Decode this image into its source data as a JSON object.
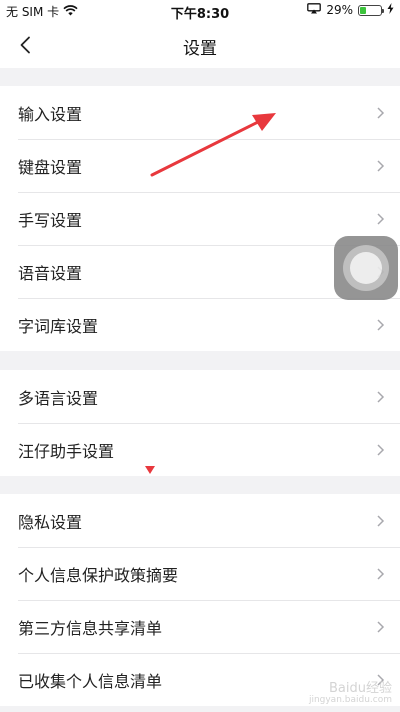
{
  "status_bar": {
    "carrier": "无 SIM 卡",
    "time": "下午8:30",
    "battery_percent": "29%",
    "battery_level": 0.29,
    "icons": [
      "wifi-icon",
      "screen-mirror-icon",
      "battery-icon",
      "charging-bolt-icon"
    ]
  },
  "nav": {
    "title": "设置",
    "back_icon": "chevron-left-icon"
  },
  "groups": [
    {
      "items": [
        {
          "label": "输入设置"
        },
        {
          "label": "键盘设置"
        },
        {
          "label": "手写设置"
        },
        {
          "label": "语音设置"
        },
        {
          "label": "字词库设置"
        }
      ]
    },
    {
      "items": [
        {
          "label": "多语言设置"
        },
        {
          "label": "汪仔助手设置"
        }
      ]
    },
    {
      "items": [
        {
          "label": "隐私设置"
        },
        {
          "label": "个人信息保护政策摘要"
        },
        {
          "label": "第三方信息共享清单"
        },
        {
          "label": "已收集个人信息清单"
        }
      ]
    }
  ],
  "colors": {
    "background": "#f2f2f4",
    "surface": "#ffffff",
    "divider": "#e6e6e8",
    "chevron": "#a8a8ad",
    "annotation_arrow": "#e8383d",
    "battery": "#3cc33c"
  },
  "watermark": {
    "line1": "Baidu经验",
    "line2": "jingyan.baidu.com"
  }
}
